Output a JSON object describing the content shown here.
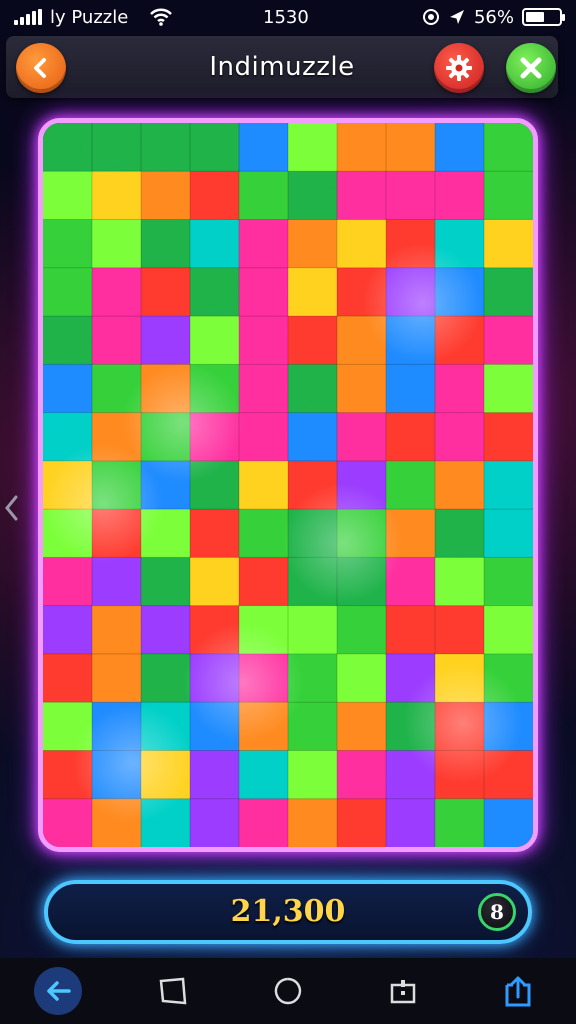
{
  "status_bar": {
    "carrier": "ly Puzzle",
    "time": "1530",
    "battery_text": "56%",
    "battery_level": 0.56
  },
  "header": {
    "title": "Indimuzzle"
  },
  "puzzle": {
    "columns": 10,
    "rows": 15,
    "palette": [
      "#ff3b2f",
      "#ff8a1f",
      "#ffd21f",
      "#36d13a",
      "#1fb34a",
      "#1e8bff",
      "#9b3cff",
      "#ff2fa0",
      "#00d0c8",
      "#7cff3a"
    ]
  },
  "score": {
    "value": "21,300",
    "moves": "8"
  },
  "colors": {
    "board_border": "#f39cff",
    "score_border": "#4cc8ff",
    "score_text": "#ffd64a"
  }
}
